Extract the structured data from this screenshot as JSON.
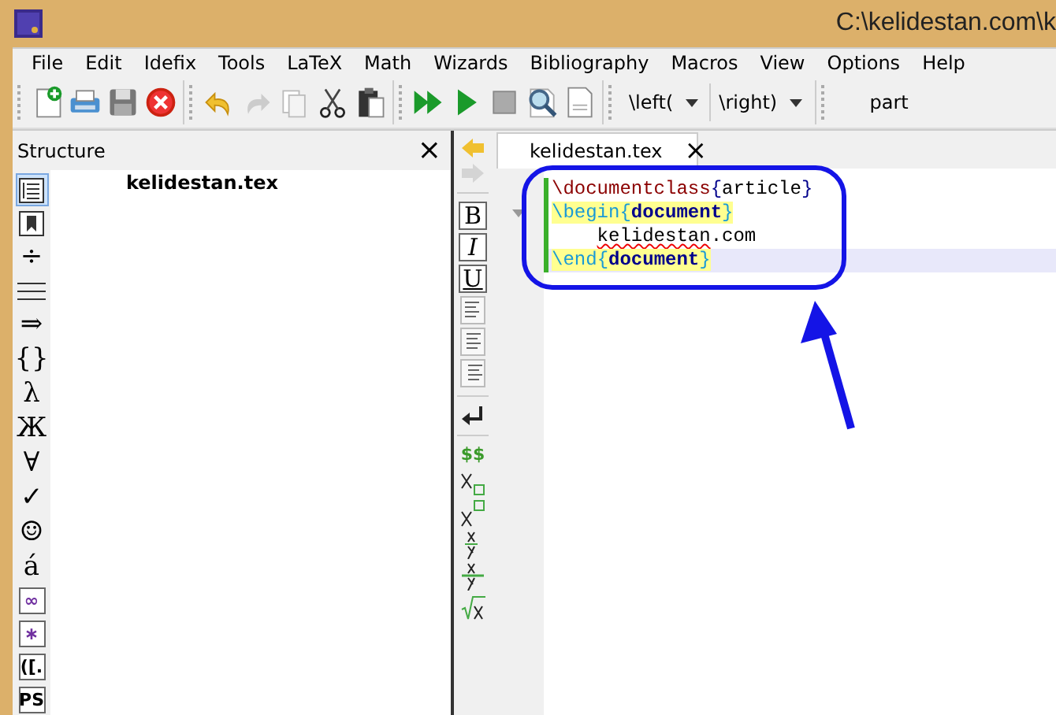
{
  "window": {
    "title": "C:\\kelidestan.com\\k"
  },
  "menu": [
    "File",
    "Edit",
    "Idefix",
    "Tools",
    "LaTeX",
    "Math",
    "Wizards",
    "Bibliography",
    "Macros",
    "View",
    "Options",
    "Help"
  ],
  "toolbar": {
    "dropdowns": [
      "\\left(",
      "\\right)"
    ],
    "section": "part"
  },
  "structure": {
    "title": "Structure",
    "close": "×",
    "tree": [
      {
        "label": "kelidestan.tex"
      }
    ],
    "tools": [
      {
        "kind": "outline",
        "selected": true
      },
      {
        "kind": "bookmark",
        "selected": false
      },
      {
        "kind": "glyph",
        "text": "÷",
        "boxed": false,
        "color": "#000000"
      },
      {
        "kind": "lines",
        "selected": false
      },
      {
        "kind": "glyph",
        "text": "⇒",
        "boxed": false,
        "color": "#000000"
      },
      {
        "kind": "glyph",
        "text": "{}",
        "boxed": false,
        "color": "#000000"
      },
      {
        "kind": "glyph",
        "text": "λ",
        "boxed": false,
        "color": "#000000"
      },
      {
        "kind": "glyph",
        "text": "Ж",
        "boxed": false,
        "color": "#000000"
      },
      {
        "kind": "glyph",
        "text": "∀",
        "boxed": false,
        "color": "#000000"
      },
      {
        "kind": "glyph",
        "text": "✓",
        "boxed": false,
        "color": "#000000"
      },
      {
        "kind": "glyph",
        "text": "☺",
        "boxed": false,
        "color": "#000000"
      },
      {
        "kind": "glyph",
        "text": "á",
        "boxed": false,
        "color": "#000000"
      },
      {
        "kind": "glyph",
        "text": "∞",
        "boxed": true,
        "color": "#7030a0"
      },
      {
        "kind": "glyph",
        "text": "∗",
        "boxed": true,
        "color": "#7030a0"
      },
      {
        "kind": "glyph",
        "text": "([.",
        "boxed": true,
        "color": "#000000"
      },
      {
        "kind": "glyph",
        "text": "PS",
        "boxed": true,
        "color": "#000000"
      }
    ]
  },
  "editor": {
    "tab": {
      "label": "kelidestan.tex",
      "close": "×",
      "selected": true
    },
    "format_buttons": [
      "B",
      "I",
      "U"
    ],
    "math_button": "$$",
    "lines": [
      {
        "current": false,
        "fold": false,
        "segments": [
          {
            "kind": "command",
            "text": "\\documentclass"
          },
          {
            "kind": "brace",
            "text": "{"
          },
          {
            "kind": "plain",
            "text": "article"
          },
          {
            "kind": "brace",
            "text": "}"
          }
        ]
      },
      {
        "current": false,
        "fold": true,
        "segments": [
          {
            "kind": "env",
            "text": "\\begin"
          },
          {
            "kind": "envbrace",
            "text": "{"
          },
          {
            "kind": "envname",
            "text": "document"
          },
          {
            "kind": "envbrace",
            "text": "}"
          }
        ]
      },
      {
        "current": false,
        "fold": false,
        "indent": true,
        "segments": [
          {
            "kind": "misspelled",
            "text": "kelidestan"
          },
          {
            "kind": "plain",
            "text": ".com"
          }
        ]
      },
      {
        "current": true,
        "fold": false,
        "segments": [
          {
            "kind": "env",
            "text": "\\end"
          },
          {
            "kind": "envbrace",
            "text": "{"
          },
          {
            "kind": "envname",
            "text": "document"
          },
          {
            "kind": "envbrace",
            "text": "}"
          }
        ]
      }
    ]
  }
}
